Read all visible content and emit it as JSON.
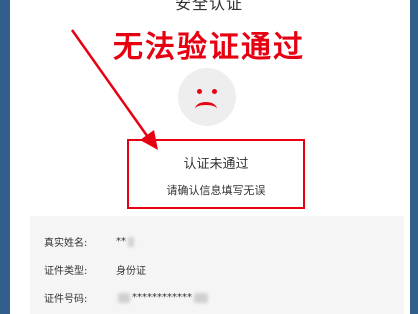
{
  "page": {
    "title": "安全认证"
  },
  "annotation": {
    "headline": "无法验证通过",
    "color": "#e60012"
  },
  "result": {
    "face_icon": "sad-face-icon",
    "status": "认证未通过",
    "hint": "请确认信息填写无误"
  },
  "info": {
    "rows": [
      {
        "label": "真实姓名:",
        "value": "**"
      },
      {
        "label": "证件类型:",
        "value": "身份证"
      },
      {
        "label": "证件号码:",
        "value": "************"
      }
    ]
  }
}
